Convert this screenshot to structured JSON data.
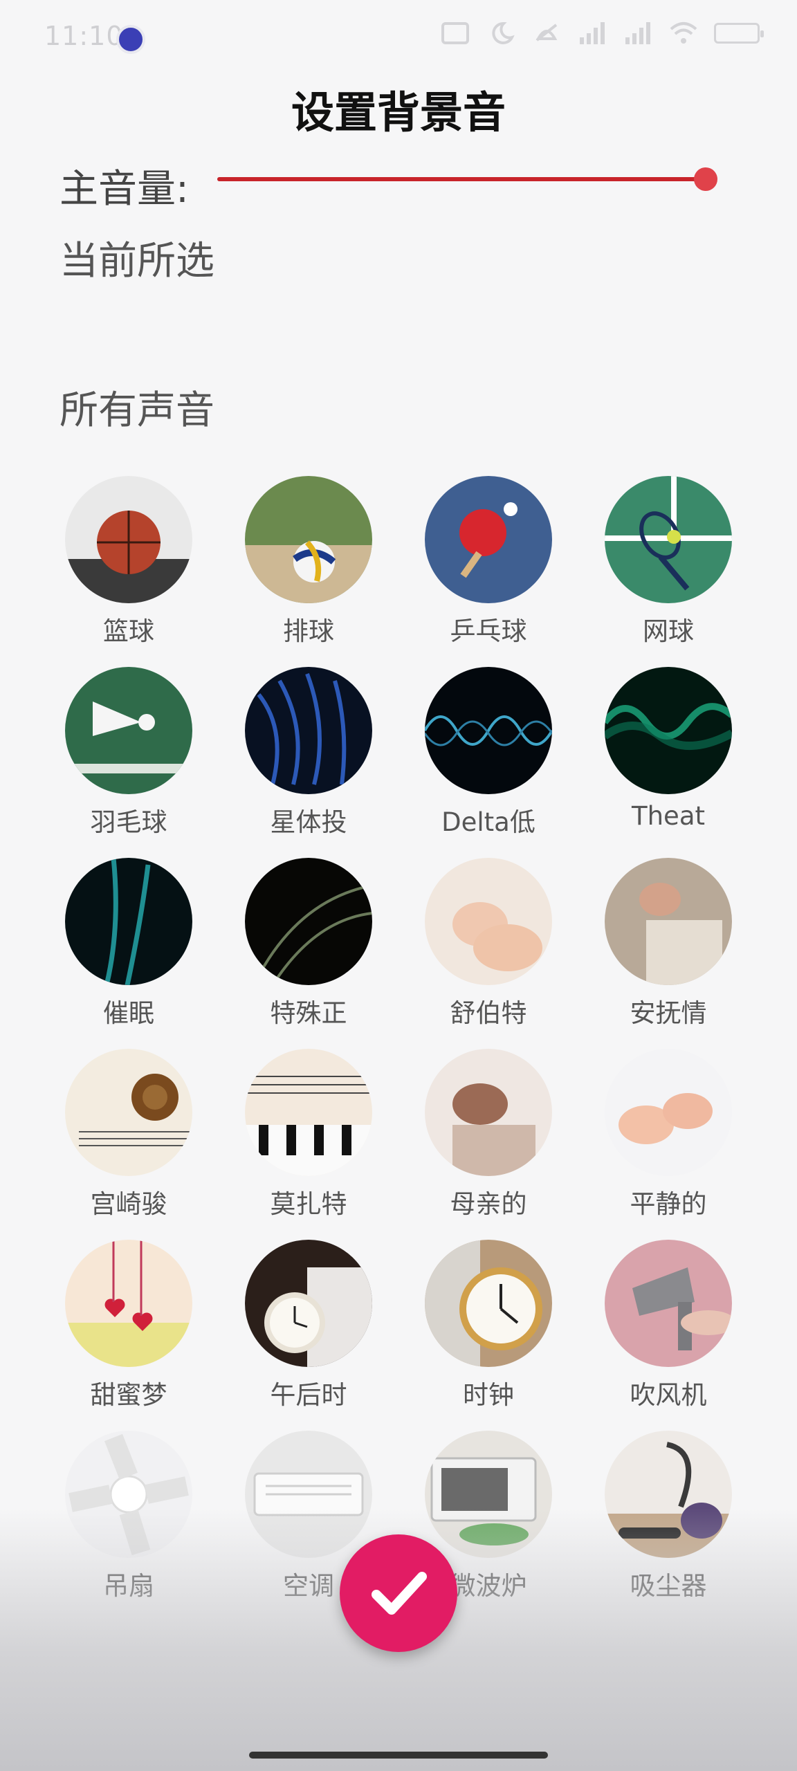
{
  "status_bar": {
    "time": "11:10"
  },
  "title": "设置背景音",
  "volume": {
    "label": "主音量:",
    "level_fraction": 1.0,
    "accent": "#c8242a"
  },
  "current": {
    "label": "当前所选"
  },
  "all_sounds": {
    "label": "所有声音"
  },
  "sounds": [
    {
      "label": "篮球",
      "icon": "basketball-icon"
    },
    {
      "label": "排球",
      "icon": "volleyball-icon"
    },
    {
      "label": "乒乓球",
      "icon": "table-tennis-icon"
    },
    {
      "label": "网球",
      "icon": "tennis-icon"
    },
    {
      "label": "羽毛球",
      "icon": "badminton-icon"
    },
    {
      "label": "星体投",
      "icon": "astral-waves-icon"
    },
    {
      "label": "Delta低",
      "icon": "delta-wave-icon"
    },
    {
      "label": "Theat",
      "icon": "theta-wave-icon"
    },
    {
      "label": "催眠",
      "icon": "hypnosis-icon"
    },
    {
      "label": "特殊正",
      "icon": "special-wave-icon"
    },
    {
      "label": "舒伯特",
      "icon": "sleeping-baby-icon"
    },
    {
      "label": "安抚情",
      "icon": "mother-baby-icon"
    },
    {
      "label": "宫崎骏",
      "icon": "violin-sheet-icon"
    },
    {
      "label": "莫扎特",
      "icon": "piano-sheet-icon"
    },
    {
      "label": "母亲的",
      "icon": "mother-cradle-icon"
    },
    {
      "label": "平静的",
      "icon": "baby-hands-icon"
    },
    {
      "label": "甜蜜梦",
      "icon": "hearts-charm-icon"
    },
    {
      "label": "午后时",
      "icon": "alarm-bed-icon"
    },
    {
      "label": "时钟",
      "icon": "alarm-clock-icon"
    },
    {
      "label": "吹风机",
      "icon": "hair-dryer-icon"
    },
    {
      "label": "吊扇",
      "icon": "ceiling-fan-icon"
    },
    {
      "label": "空调",
      "icon": "air-conditioner-icon"
    },
    {
      "label": "微波炉",
      "icon": "microwave-icon"
    },
    {
      "label": "吸尘器",
      "icon": "vacuum-cleaner-icon"
    }
  ],
  "confirm": {
    "icon": "check-icon",
    "color": "#e21c64"
  }
}
